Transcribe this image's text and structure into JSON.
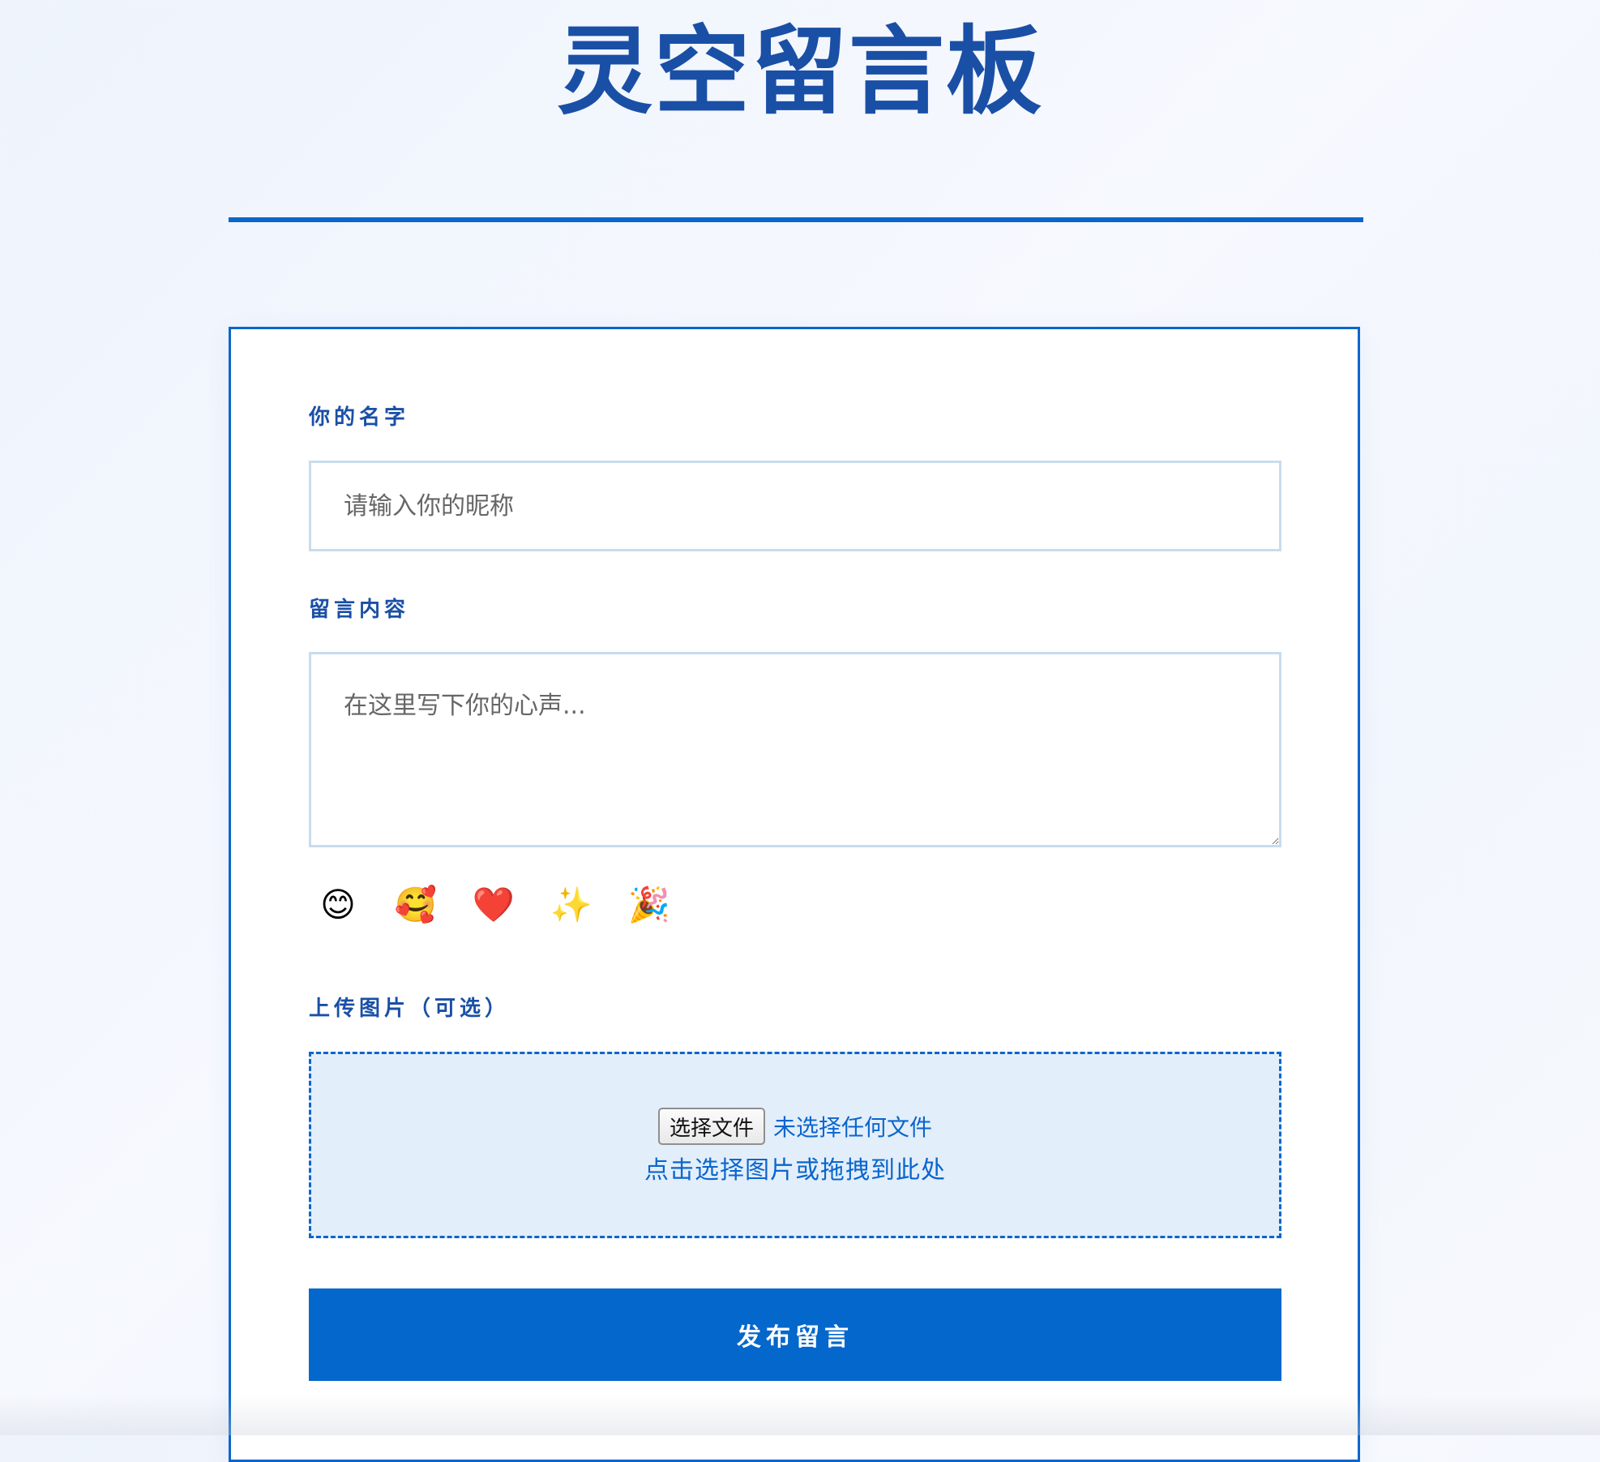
{
  "page": {
    "title": "灵空留言板"
  },
  "form": {
    "name_label": "你的名字",
    "name_placeholder": "请输入你的昵称",
    "name_value": "",
    "message_label": "留言内容",
    "message_placeholder": "在这里写下你的心声...",
    "message_value": "",
    "emojis": [
      {
        "glyph": "😊",
        "name": "smiling-face-icon"
      },
      {
        "glyph": "🥰",
        "name": "smiling-face-hearts-icon"
      },
      {
        "glyph": "❤️",
        "name": "red-heart-icon"
      },
      {
        "glyph": "✨",
        "name": "sparkles-icon"
      },
      {
        "glyph": "🎉",
        "name": "party-popper-icon"
      }
    ],
    "upload_label": "上传图片（可选）",
    "upload_button_label": "选择文件",
    "upload_status": "未选择任何文件",
    "upload_hint": "点击选择图片或拖拽到此处",
    "submit_label": "发布留言"
  },
  "colors": {
    "accent": "#0a66cc",
    "title": "#1a4fa6",
    "upload_background": "#e3eefb",
    "input_border": "#c9dcef"
  }
}
